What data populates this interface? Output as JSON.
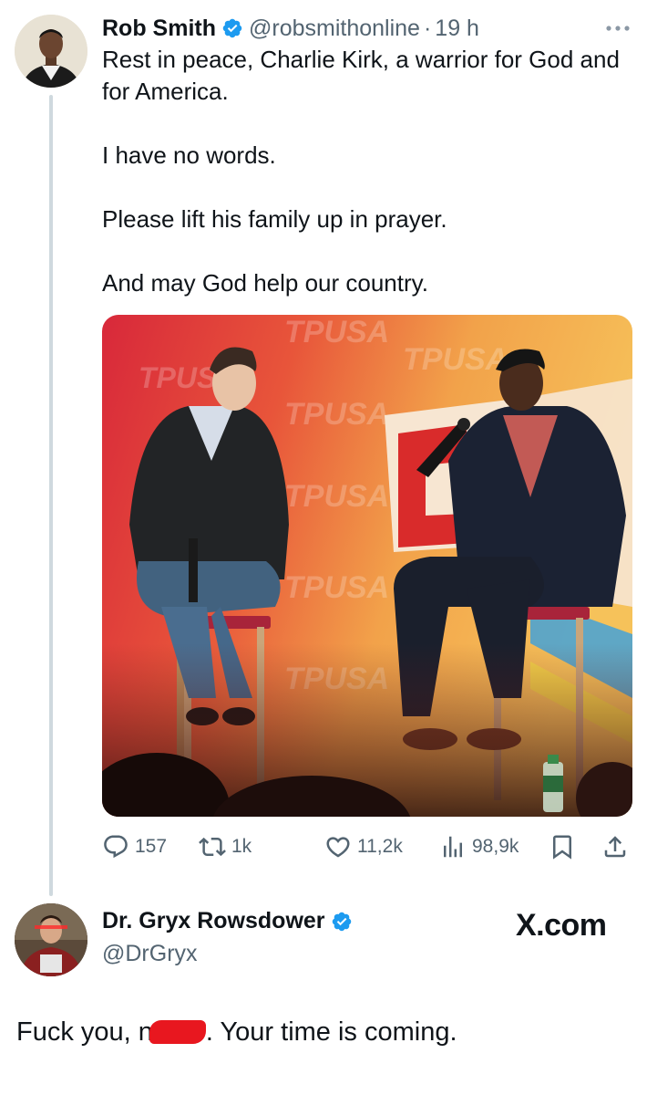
{
  "tweet": {
    "author_name": "Rob Smith",
    "handle": "@robsmithonline",
    "separator": "·",
    "time": "19 h",
    "paragraphs": [
      "Rest in peace, Charlie Kirk, a warrior for God and for America.",
      "I have no words.",
      "Please lift his family up in prayer.",
      "And may God help our country."
    ],
    "image_banner_text": "TPUSA",
    "stats": {
      "replies": "157",
      "reposts": "1k",
      "likes": "11,2k",
      "views": "98,9k"
    }
  },
  "reply_card": {
    "author_name": "Dr. Gryx Rowsdower",
    "handle": "@DrGryx",
    "source_label": "X.com",
    "reply_text_start": "Fuck you, n",
    "reply_text_end": ". Your time is coming."
  },
  "colors": {
    "verified": "#1d9bf0",
    "secondary_text": "#536471",
    "thread_line": "#cfd9de",
    "redaction": "#e8171f"
  }
}
